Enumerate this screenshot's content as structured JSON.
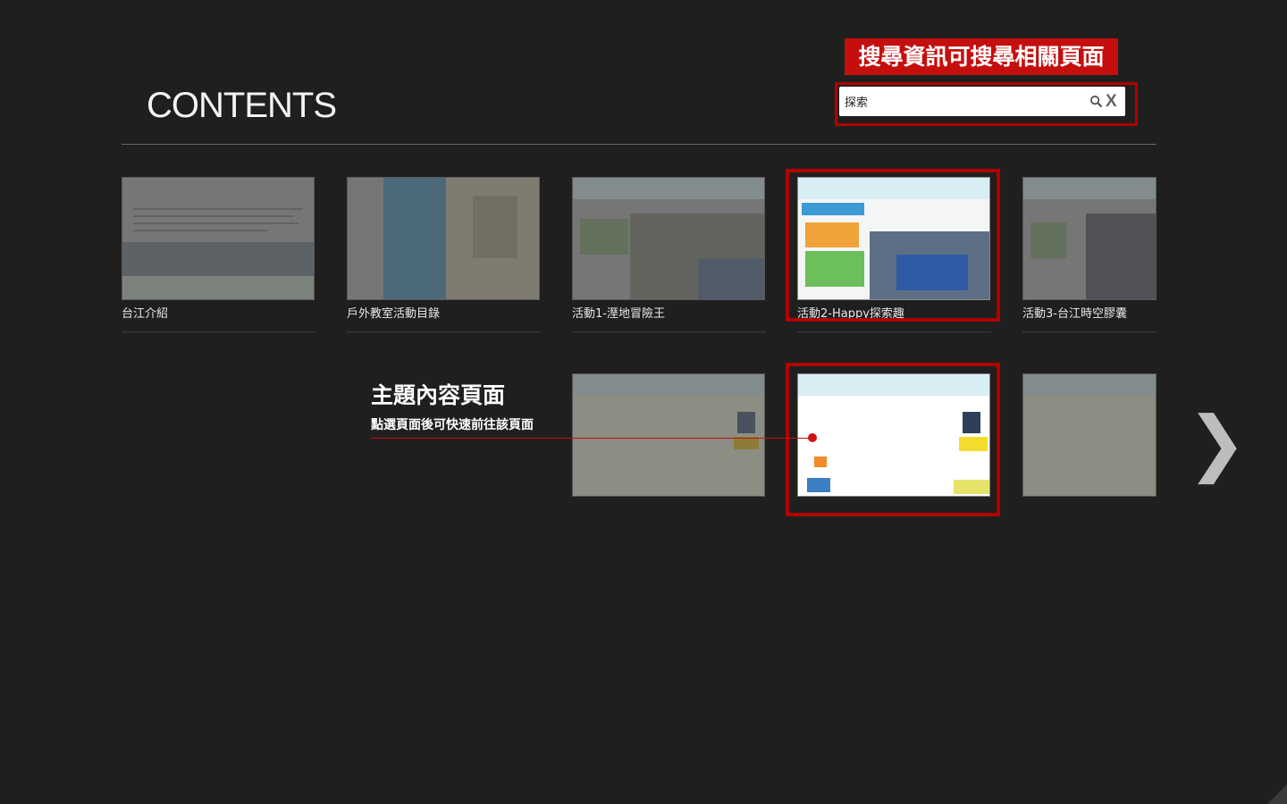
{
  "header": {
    "title": "CONTENTS"
  },
  "search": {
    "annotation": "搜尋資訊可搜尋相關頁面",
    "value": "探索",
    "search_icon": "search-icon",
    "clear_label": "X"
  },
  "pages": [
    {
      "label": "台江介紹"
    },
    {
      "label": "戶外教室活動目錄"
    },
    {
      "label": "活動1-溼地冒險王"
    },
    {
      "label": "活動2-Happy探索趣"
    },
    {
      "label": "活動3-台江時空膠囊"
    }
  ],
  "theme_note": {
    "title": "主題內容頁面",
    "subtitle": "點選頁面後可快速前往該頁面"
  },
  "nav": {
    "next_symbol": "❯"
  },
  "colors": {
    "background": "#1f1f1f",
    "highlight": "#b10000",
    "accent_red": "#c50f0f"
  }
}
